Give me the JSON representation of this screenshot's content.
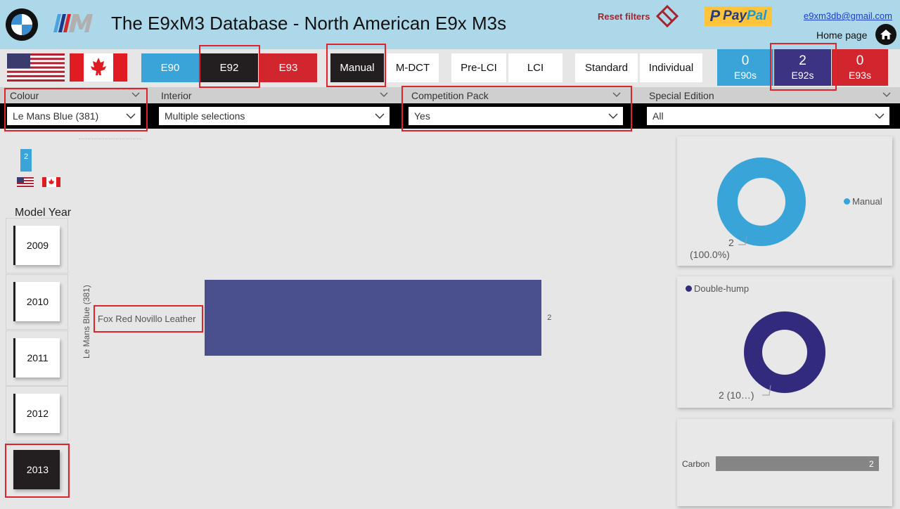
{
  "header": {
    "title": "The E9xM3 Database - North American E9x M3s",
    "reset_label": "Reset filters",
    "paypal_label": "PayPal",
    "email": "e9xm3db@gmail.com",
    "home_label": "Home page"
  },
  "model_buttons": [
    {
      "label": "E90",
      "state": "unselected"
    },
    {
      "label": "E92",
      "state": "selected"
    },
    {
      "label": "E93",
      "state": "unselected"
    }
  ],
  "transmission_buttons": [
    {
      "label": "Manual",
      "state": "selected"
    },
    {
      "label": "M-DCT",
      "state": "unselected"
    }
  ],
  "lci_buttons": [
    {
      "label": "Pre-LCI"
    },
    {
      "label": "LCI"
    }
  ],
  "type_buttons": [
    {
      "label": "Standard"
    },
    {
      "label": "Individual"
    }
  ],
  "counts": [
    {
      "value": "0",
      "label": "E90s"
    },
    {
      "value": "2",
      "label": "E92s"
    },
    {
      "value": "0",
      "label": "E93s"
    }
  ],
  "filters": {
    "colour": {
      "label": "Colour",
      "value": "Le Mans Blue (381)"
    },
    "interior": {
      "label": "Interior",
      "value": "Multiple selections"
    },
    "competition": {
      "label": "Competition Pack",
      "value": "Yes"
    },
    "special": {
      "label": "Special Edition",
      "value": "All"
    }
  },
  "left_panel": {
    "count": "2",
    "model_year_label": "Model Year",
    "years": [
      {
        "label": "2009",
        "selected": false
      },
      {
        "label": "2010",
        "selected": false
      },
      {
        "label": "2011",
        "selected": false
      },
      {
        "label": "2012",
        "selected": false
      },
      {
        "label": "2013",
        "selected": true
      }
    ]
  },
  "colors": {
    "blue": "#3aa3d8",
    "dark": "#231f20",
    "red": "#d1262d",
    "navy": "#3c3482",
    "bar": "#4a508e",
    "highlight": "#e0232a"
  },
  "chart_data": [
    {
      "type": "bar",
      "orientation": "horizontal",
      "ylabel": "Le Mans Blue (381)",
      "categories": [
        "Fox Red Novillo Leather"
      ],
      "values": [
        2
      ],
      "xlim": [
        0,
        2.6
      ],
      "data_labels": [
        "2"
      ]
    },
    {
      "type": "pie",
      "style": "donut",
      "labels": [
        "Manual"
      ],
      "values": [
        2
      ],
      "data_labels": [
        "2",
        "(100.0%)"
      ],
      "legend": "right"
    },
    {
      "type": "pie",
      "style": "donut",
      "labels": [
        "Double-hump"
      ],
      "values": [
        2
      ],
      "data_labels": [
        "2 (10…)"
      ],
      "legend": "top-left"
    },
    {
      "type": "bar",
      "orientation": "horizontal",
      "categories": [
        "Carbon"
      ],
      "values": [
        2
      ],
      "xlim": [
        0,
        2
      ],
      "data_labels": [
        "2"
      ]
    }
  ]
}
